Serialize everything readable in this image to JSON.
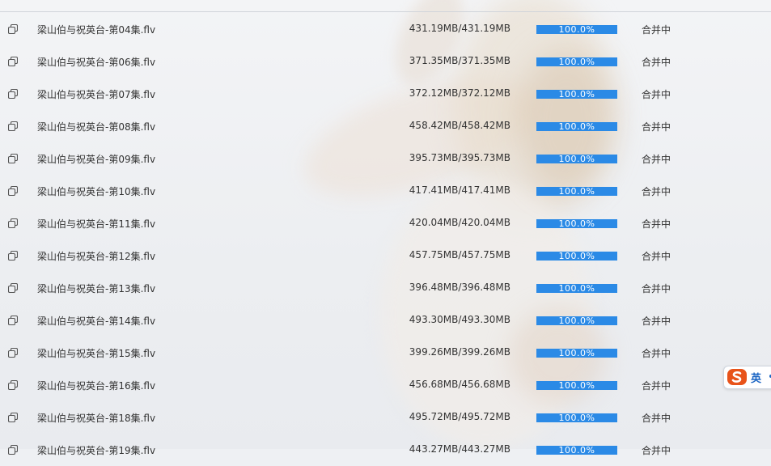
{
  "colors": {
    "progress_fill": "#2b8ae6",
    "progress_track": "#d7d7d7",
    "text": "#333333",
    "ime_accent": "#e8531a"
  },
  "rows": [
    {
      "name": "梁山伯与祝英台-第04集.flv",
      "size": "431.19MB/431.19MB",
      "progress": 1.0,
      "progress_text": "100.0%",
      "status": "合并中"
    },
    {
      "name": "梁山伯与祝英台-第06集.flv",
      "size": "371.35MB/371.35MB",
      "progress": 1.0,
      "progress_text": "100.0%",
      "status": "合并中"
    },
    {
      "name": "梁山伯与祝英台-第07集.flv",
      "size": "372.12MB/372.12MB",
      "progress": 1.0,
      "progress_text": "100.0%",
      "status": "合并中"
    },
    {
      "name": "梁山伯与祝英台-第08集.flv",
      "size": "458.42MB/458.42MB",
      "progress": 1.0,
      "progress_text": "100.0%",
      "status": "合并中"
    },
    {
      "name": "梁山伯与祝英台-第09集.flv",
      "size": "395.73MB/395.73MB",
      "progress": 1.0,
      "progress_text": "100.0%",
      "status": "合并中"
    },
    {
      "name": "梁山伯与祝英台-第10集.flv",
      "size": "417.41MB/417.41MB",
      "progress": 1.0,
      "progress_text": "100.0%",
      "status": "合并中"
    },
    {
      "name": "梁山伯与祝英台-第11集.flv",
      "size": "420.04MB/420.04MB",
      "progress": 1.0,
      "progress_text": "100.0%",
      "status": "合并中"
    },
    {
      "name": "梁山伯与祝英台-第12集.flv",
      "size": "457.75MB/457.75MB",
      "progress": 1.0,
      "progress_text": "100.0%",
      "status": "合并中"
    },
    {
      "name": "梁山伯与祝英台-第13集.flv",
      "size": "396.48MB/396.48MB",
      "progress": 1.0,
      "progress_text": "100.0%",
      "status": "合并中"
    },
    {
      "name": "梁山伯与祝英台-第14集.flv",
      "size": "493.30MB/493.30MB",
      "progress": 1.0,
      "progress_text": "100.0%",
      "status": "合并中"
    },
    {
      "name": "梁山伯与祝英台-第15集.flv",
      "size": "399.26MB/399.26MB",
      "progress": 1.0,
      "progress_text": "100.0%",
      "status": "合并中"
    },
    {
      "name": "梁山伯与祝英台-第16集.flv",
      "size": "456.68MB/456.68MB",
      "progress": 1.0,
      "progress_text": "100.0%",
      "status": "合并中"
    },
    {
      "name": "梁山伯与祝英台-第18集.flv",
      "size": "495.72MB/495.72MB",
      "progress": 1.0,
      "progress_text": "100.0%",
      "status": "合并中"
    },
    {
      "name": "梁山伯与祝英台-第19集.flv",
      "size": "443.27MB/443.27MB",
      "progress": 1.0,
      "progress_text": "100.0%",
      "status": "合并中"
    }
  ],
  "ime": {
    "icon": "sogou-ime-logo",
    "mode_label": "英"
  }
}
